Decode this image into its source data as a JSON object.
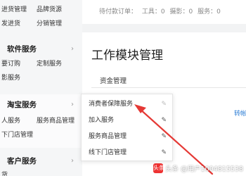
{
  "sidebar": {
    "row1": [
      "进货管理",
      "品牌货源"
    ],
    "row2": [
      "发进货",
      "分销管理"
    ],
    "software": {
      "title": "软件服务",
      "items_row1": [
        "要订购",
        "定制服务"
      ],
      "items_row2": [
        "影服务"
      ]
    },
    "taobao": {
      "title": "淘宝服务",
      "items_row1": [
        "人服务",
        "服务商品管理"
      ],
      "items_row2": [
        "下门店管理"
      ]
    },
    "customer": {
      "title": "客户服务",
      "items_row1": [
        "货"
      ]
    }
  },
  "main": {
    "stats": [
      "待付款订单：",
      "工具：0",
      "摄影：0",
      "服务：0"
    ],
    "page_title": "工作模块管理",
    "section": "资金管理",
    "link": "转帐"
  },
  "popup": {
    "items": [
      "消费者保障服务",
      "加入服务",
      "服务商品管理",
      "线下门店管理"
    ]
  },
  "watermark": {
    "text": "头条 @用户1004815538",
    "logo": "头条"
  },
  "colors": {
    "arrow": "#e53935",
    "link": "#2f7fd6",
    "sidebar_bg": "#f5f6f7"
  }
}
